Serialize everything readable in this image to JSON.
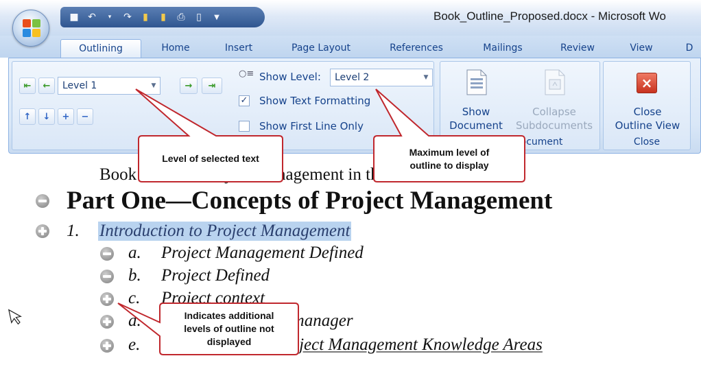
{
  "window": {
    "title": "Book_Outline_Proposed.docx - Microsoft Wo"
  },
  "quick_access": [
    "save-icon",
    "undo-icon",
    "undo-dropdown-icon",
    "redo-icon",
    "open-folder-icon",
    "folder-icon",
    "print-icon",
    "new-document-icon",
    "customize-dropdown-icon"
  ],
  "tabs": [
    {
      "label": "Outlining",
      "active": true
    },
    {
      "label": "Home"
    },
    {
      "label": "Insert"
    },
    {
      "label": "Page Layout"
    },
    {
      "label": "References"
    },
    {
      "label": "Mailings"
    },
    {
      "label": "Review"
    },
    {
      "label": "View"
    },
    {
      "label": "D"
    }
  ],
  "ribbon": {
    "outline_tools": {
      "level_value": "Level 1",
      "show_level_label": "Show Level:",
      "show_level_value": "Level 2",
      "show_text_formatting": {
        "label": "Show Text Formatting",
        "checked": true
      },
      "show_first_line_only": {
        "label": "Show First Line Only",
        "checked": false
      }
    },
    "master_document": {
      "show_document": [
        "Show",
        "Document"
      ],
      "collapse_subdocuments": [
        "Collapse",
        "Subdocuments"
      ],
      "group_label": "Master Document"
    },
    "close_group": {
      "close_outline_view": [
        "Close",
        "Outline View"
      ],
      "group_label": "Close"
    }
  },
  "document": {
    "book_title": "Book Outline: Project Management in the Real World",
    "lines": [
      {
        "text": "Part One—Concepts of Project Management",
        "symbol": "minus"
      },
      {
        "num": "1.",
        "text": "Introduction to Project Management",
        "symbol": "plus",
        "selected": true
      },
      {
        "num": "a.",
        "text": "Project Management Defined",
        "symbol": "minus"
      },
      {
        "num": "b.",
        "text": "Project  Defined",
        "symbol": "minus"
      },
      {
        "num": "c.",
        "text": "Project context",
        "symbol": "plus"
      },
      {
        "num": "d.",
        "text": "Role of the project manager",
        "symbol": "plus"
      },
      {
        "num": "e.",
        "text": "Overview of the Project Management Knowledge Areas",
        "symbol": "plus"
      }
    ]
  },
  "callouts": {
    "level": "Level of selected text",
    "max_level": [
      "Maximum level of",
      "outline to display"
    ],
    "additional": [
      "Indicates additional",
      "levels of outline not",
      "displayed"
    ]
  },
  "colors": {
    "ribbon_text": "#15428b",
    "selection_highlight": "#b9d3ef",
    "callout_border": "#c0272d",
    "close_button": "#d9432f"
  }
}
